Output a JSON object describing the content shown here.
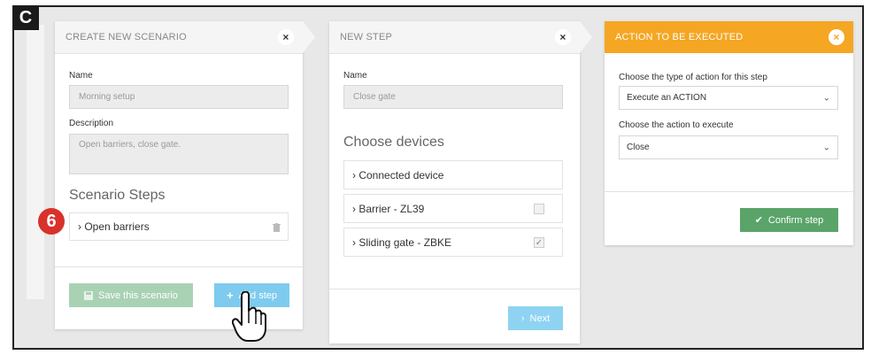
{
  "figure_label": "C",
  "step_badge": "6",
  "create_panel": {
    "title": "CREATE NEW SCENARIO",
    "close_glyph": "×",
    "name_label": "Name",
    "name_value": "Morning setup",
    "description_label": "Description",
    "description_value": "Open barriers, close gate.",
    "steps_title": "Scenario Steps",
    "steps": [
      {
        "label": "› Open barriers",
        "icon": "trash-icon"
      }
    ],
    "save_button": "Save this scenario",
    "save_icon": "floppy-disk-icon",
    "add_step_button": "Add step",
    "add_step_icon": "plus-icon"
  },
  "step_panel": {
    "title": "NEW STEP",
    "close_glyph": "×",
    "name_label": "Name",
    "name_value": "Close gate",
    "devices_title": "Choose devices",
    "devices": [
      {
        "label": "› Connected device",
        "checkbox": "none",
        "checked": false
      },
      {
        "label": "› Barrier - ZL39",
        "checkbox": "shown",
        "checked": false
      },
      {
        "label": "› Sliding gate - ZBKE",
        "checkbox": "shown",
        "checked": true
      }
    ],
    "next_button": "Next",
    "next_icon": "chevron-right-icon"
  },
  "action_panel": {
    "title": "ACTION TO BE EXECUTED",
    "close_glyph": "×",
    "header_color": "#f5a623",
    "action_type_label": "Choose the type of action for this step",
    "action_type_value": "Execute an ACTION",
    "action_label": "Choose the action to execute",
    "action_value": "Close",
    "confirm_button": "Confirm step",
    "confirm_icon": "check-icon"
  },
  "colors": {
    "save_green": "#a9d2b4",
    "add_blue": "#7ecbef",
    "next_blue": "#8fd3f2",
    "confirm_green": "#5aa469",
    "badge_red": "#d8322a"
  }
}
